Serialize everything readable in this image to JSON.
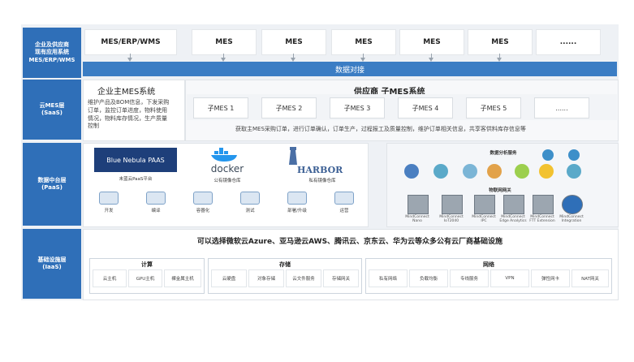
{
  "layers": {
    "top": "企业及供应商\n现有应用系统\nMES/ERP/WMS",
    "saas": "云MES层\n(SaaS)",
    "paas": "数据中台层\n(PaaS)",
    "iaas": "基础设施层\n(IaaS)"
  },
  "top_systems": [
    "MES/ERP/WMS",
    "MES",
    "MES",
    "MES",
    "MES",
    "MES",
    "......"
  ],
  "data_band": "数据对接",
  "enterprise": {
    "title": "企业主MES系统",
    "desc": "维护产品及BOM信息，下发采购\n订单，监控订单进度，物料使用\n情况，物料库存情况，生产质量\n控制"
  },
  "supplier": {
    "title": "供应商 子MES系统",
    "subs": [
      "子MES 1",
      "子MES 2",
      "子MES 3",
      "子MES 4",
      "子MES 5",
      "......"
    ],
    "desc": "获取主MES采购订单，进行订单确认，订单生产，过程报工及质量控制，维护订单相关信息，共享客供料库存信息等"
  },
  "platforms": {
    "blue_nebula": "Blue Nebula PAAS",
    "blue_nebula_cap": "未蓝云PaaS平台",
    "docker": "docker",
    "docker_cap": "公有镜像仓库",
    "harbor": "HARBOR",
    "harbor_cap": "私有镜像仓库"
  },
  "devops": [
    "开发",
    "编译",
    "容器化",
    "测试",
    "部署/升级",
    "运营"
  ],
  "analysis_title": "数据分析服务",
  "iot_title": "物联网网关",
  "iot_devices": [
    "MindConnect Nano",
    "MindConnect IoT2040",
    "MindConnect IPC",
    "MindConnect Edge Analytics",
    "MindConnect FTT Extension",
    "MindConnect Integration"
  ],
  "infra": {
    "headline": "可以选择微软云Azure、亚马逊云AWS、腾讯云、京东云、华为云等众多公有云厂商基础设施",
    "compute": {
      "title": "计算",
      "items": [
        "云主机",
        "GPU主机",
        "裸金属主机"
      ]
    },
    "storage": {
      "title": "存储",
      "items": [
        "云硬盘",
        "对象存储",
        "云文件服务",
        "存储网关"
      ]
    },
    "network": {
      "title": "网络",
      "items": [
        "私有网络",
        "负载均衡",
        "专线服务",
        "VPN",
        "弹性网卡",
        "NAT网关"
      ]
    }
  }
}
